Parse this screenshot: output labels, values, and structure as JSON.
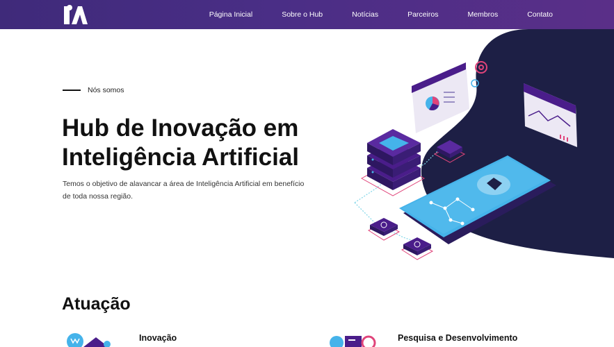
{
  "nav": {
    "items": [
      "Página Inicial",
      "Sobre o Hub",
      "Notícias",
      "Parceiros",
      "Membros",
      "Contato"
    ]
  },
  "colors": {
    "nav_start": "#3f2a7a",
    "nav_end": "#5a2f88",
    "blob": "#1d1f45",
    "accent_blue": "#45b3ea",
    "accent_purple": "#4a1d8a",
    "accent_pink": "#e0447a"
  },
  "hero": {
    "eyebrow": "Nós somos",
    "title": "Hub de Inovação em Inteligência Artificial",
    "description": "Temos o objetivo de alavancar a área de Inteligência Artificial em benefício de toda nossa região."
  },
  "section": {
    "title": "Atuação",
    "cards": [
      {
        "title": "Inovação",
        "icon": "innovation-icon"
      },
      {
        "title": "Pesquisa e Desenvolvimento",
        "icon": "research-icon"
      }
    ]
  },
  "icons": {
    "logo": "ia-logo",
    "illustration": "ai-isometric-illustration"
  }
}
